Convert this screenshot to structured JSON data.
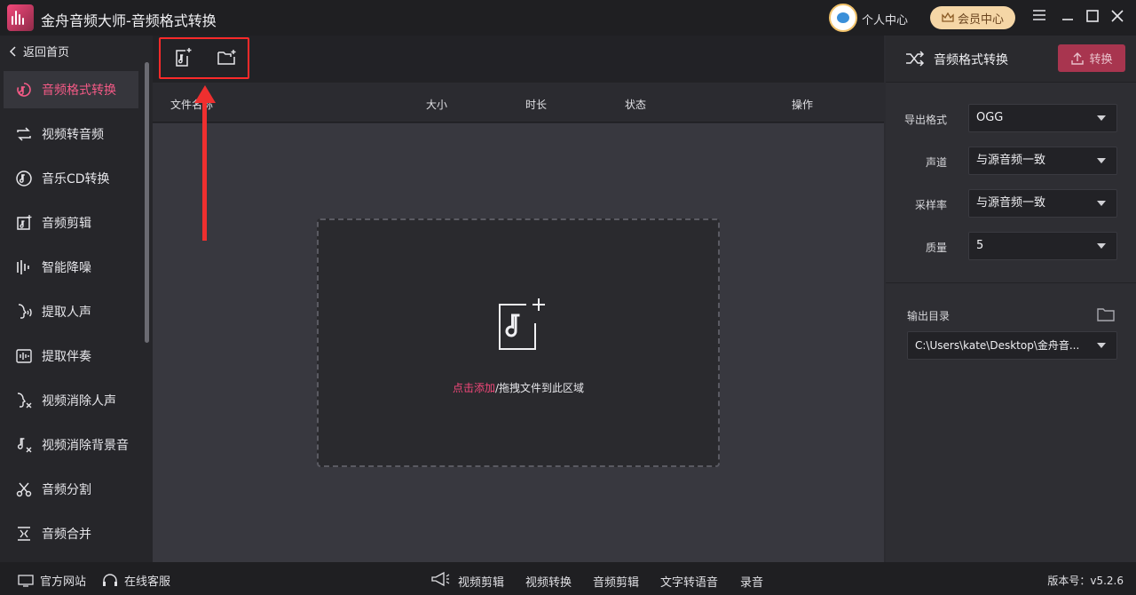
{
  "app": {
    "title": "金舟音频大师-音频格式转换",
    "user_center": "个人中心",
    "vip_center": "会员中心"
  },
  "sidebar": {
    "back": "返回首页",
    "items": [
      {
        "label": "音频格式转换",
        "icon": "audio-convert-icon",
        "active": true
      },
      {
        "label": "视频转音频",
        "icon": "loop-icon"
      },
      {
        "label": "音乐CD转换",
        "icon": "music-cd-icon"
      },
      {
        "label": "音频剪辑",
        "icon": "audio-cut-icon"
      },
      {
        "label": "智能降噪",
        "icon": "noise-reduce-icon"
      },
      {
        "label": "提取人声",
        "icon": "voice-icon"
      },
      {
        "label": "提取伴奏",
        "icon": "waveform-icon"
      },
      {
        "label": "视频消除人声",
        "icon": "remove-voice-icon"
      },
      {
        "label": "视频消除背景音",
        "icon": "remove-bg-audio-icon"
      },
      {
        "label": "音频分割",
        "icon": "scissors-icon"
      },
      {
        "label": "音频合并",
        "icon": "merge-icon"
      }
    ]
  },
  "table": {
    "columns": [
      "文件名称",
      "大小",
      "时长",
      "状态",
      "操作"
    ]
  },
  "dropzone": {
    "click_add": "点击添加",
    "drag_text": "/拖拽文件到此区域"
  },
  "panel": {
    "title": "音频格式转换",
    "convert_button": "转换",
    "fields": [
      {
        "label": "导出格式",
        "value": "OGG"
      },
      {
        "label": "声道",
        "value": "与源音频一致"
      },
      {
        "label": "采样率",
        "value": "与源音频一致"
      },
      {
        "label": "质量",
        "value": "5"
      }
    ],
    "output_label": "输出目录",
    "output_path": "C:\\Users\\kate\\Desktop\\金舟音..."
  },
  "footer": {
    "website": "官方网站",
    "support": "在线客服",
    "links": [
      "视频剪辑",
      "视频转换",
      "音频剪辑",
      "文字转语音",
      "录音"
    ],
    "version": "版本号：v5.2.6"
  },
  "colors": {
    "accent": "#f2487a",
    "highlight": "#ff2a2a",
    "convert": "#a8354f"
  }
}
